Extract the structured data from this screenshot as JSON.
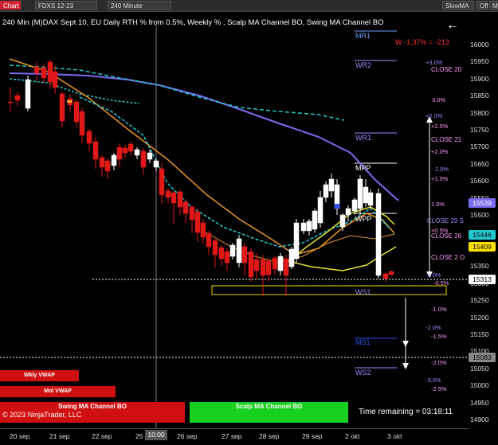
{
  "toolbar": {
    "chart_label": "Chart",
    "instrument": "FDXS 12-23",
    "interval": "240 Minute",
    "slowma": "SlowMA",
    "off": "Off",
    "mvwap": "M VWAP"
  },
  "title": "240 Min (M)DAX Sept 10, EU Daily RTH % from 0.5%, Weekly % , Scalp MA Channel BO, Swing MA Channel BO",
  "colors": {
    "background": "#000000",
    "purple_ma": "#7a6cf0",
    "cyan_ma": "#22c8d0",
    "orange_ma": "#e8952a",
    "yellow_ma": "#e8e030",
    "bear_candle": "#e01818",
    "bull_candle": "#ffffff",
    "swing_box": "#d01010",
    "scalp_box": "#18d020"
  },
  "price_axis": {
    "ticks": [
      "16000",
      "15950",
      "15900",
      "15850",
      "15800",
      "15750",
      "15700",
      "15650",
      "15600",
      "15550",
      "15500",
      "15450",
      "15400",
      "15350",
      "15300",
      "15250",
      "15200",
      "15150",
      "15100",
      "15050",
      "15000",
      "14950",
      "14900"
    ],
    "tags": [
      {
        "label": "15539",
        "bg": "#7a6cf0",
        "fg": "#fff"
      },
      {
        "label": "15446",
        "bg": "#22c8d0",
        "fg": "#000"
      },
      {
        "label": "15409",
        "bg": "#ffe000",
        "fg": "#000"
      },
      {
        "label": "15313",
        "bg": "#ffffff",
        "fg": "#000"
      },
      {
        "label": "15083",
        "bg": "#888888",
        "fg": "#000"
      }
    ]
  },
  "time_axis": {
    "labels": [
      "20 sep",
      "21 sep",
      "22 sep",
      "25",
      "26 sep",
      "27 sep",
      "28 sep",
      "29 sep",
      "2 okt",
      "3 okt"
    ],
    "cursor": "10:00"
  },
  "levels": {
    "mr1": "MR1",
    "wr2": "WR2",
    "wr1": "WR1",
    "mpp": "MPP",
    "wpp": "WPP",
    "ws1": "WS1",
    "ms1": "MS1",
    "ws2": "WS2"
  },
  "weekly_change": "W -1,37% = -213",
  "pct_labels": {
    "p30a": "+3.0%",
    "p30b": "3.0%",
    "p20a": "+2.0%",
    "p25": "+2.5%",
    "p20b": "+2.0%",
    "p20c": "2.0%",
    "p15": "+1.5%",
    "p10": "1.0%",
    "p05": "+0.5%",
    "m10a": "-1.0%",
    "m05": "-0.5%",
    "m10b": "-1.0%",
    "m20a": "-2.0%",
    "m15": "-1.5%",
    "m20b": "-2.0%",
    "m30": "-3.0%",
    "m25": "-2.5%"
  },
  "close_labels": {
    "c1": "CLOSE 20",
    "c2": "CLOSE 21",
    "c3": "CLOSE 29 S",
    "c4": "CLOSE 26",
    "c5": "CLOSE 2 O"
  },
  "vwap_boxes": {
    "wkly": "Wkly VWAP",
    "mnl": "Mnl VWAP"
  },
  "channel_boxes": {
    "swing": "Swing MA Channel BO",
    "scalp": "Scalp MA Channel BO"
  },
  "copyright": "© 2023 NinjaTrader, LLC",
  "time_remaining": "Time remaining = 03:18:11"
}
